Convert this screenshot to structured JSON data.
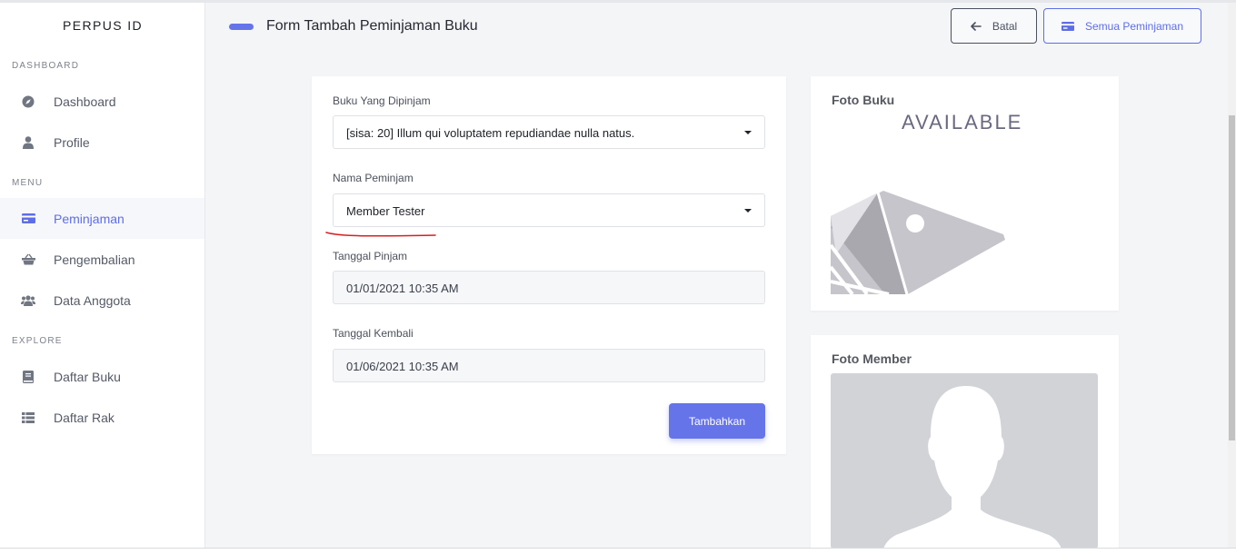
{
  "app": {
    "brand": "PERPUS ID"
  },
  "sidebar": {
    "sections": [
      {
        "title": "DASHBOARD"
      },
      {
        "title": "MENU"
      },
      {
        "title": "EXPLORE"
      }
    ],
    "items": [
      {
        "label": "Dashboard",
        "icon": "compass-icon"
      },
      {
        "label": "Profile",
        "icon": "user-icon"
      },
      {
        "label": "Peminjaman",
        "icon": "card-icon",
        "active": true
      },
      {
        "label": "Pengembalian",
        "icon": "basket-icon"
      },
      {
        "label": "Data Anggota",
        "icon": "users-icon"
      },
      {
        "label": "Daftar Buku",
        "icon": "book-icon"
      },
      {
        "label": "Daftar Rak",
        "icon": "list-icon"
      }
    ]
  },
  "header": {
    "title": "Form Tambah Peminjaman Buku",
    "back_label": "Batal",
    "all_label": "Semua Peminjaman"
  },
  "form": {
    "book_label": "Buku Yang Dipinjam",
    "book_value": "[sisa: 20] Illum qui voluptatem repudiandae nulla natus.",
    "borrower_label": "Nama Peminjam",
    "borrower_value": "Member Tester",
    "borrow_date_label": "Tanggal Pinjam",
    "borrow_date_value": "01/01/2021 10:35 AM",
    "return_date_label": "Tanggal Kembali",
    "return_date_value": "01/06/2021 10:35 AM",
    "submit_label": "Tambahkan"
  },
  "photos": {
    "book_title": "Foto Buku",
    "book_placeholder_text": "AVAILABLE",
    "member_title": "Foto Member"
  },
  "colors": {
    "accent": "#6674ea",
    "annotation": "#d42020"
  }
}
